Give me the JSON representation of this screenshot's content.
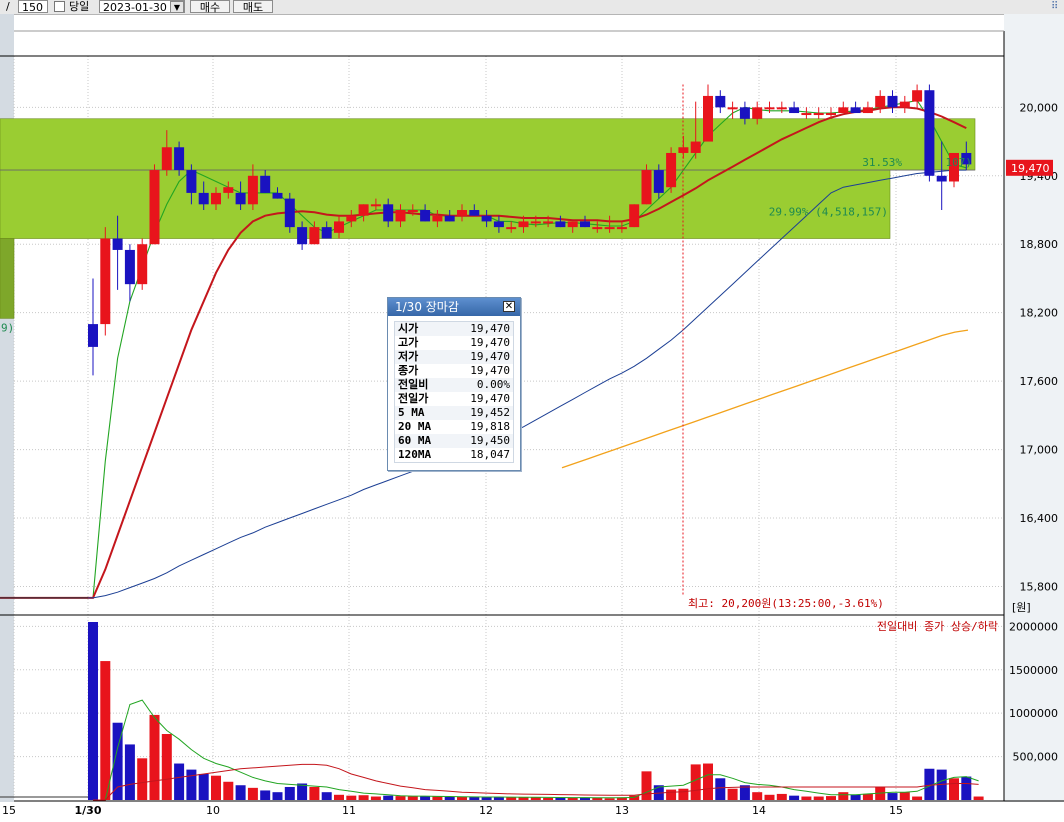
{
  "toolbar": {
    "slash": "/",
    "period": "150",
    "sameday_label": "당일",
    "date": "2023-01-30",
    "buy_label": "매수",
    "sell_label": "매도",
    "settings_icon": "grid-dots-icon",
    "dropdown_icon": "triangle-down-icon"
  },
  "popup": {
    "title": "1/30 장마감",
    "close_icon": "close-icon",
    "rows": [
      {
        "label": "시가",
        "value": "19,470"
      },
      {
        "label": "고가",
        "value": "19,470"
      },
      {
        "label": "저가",
        "value": "19,470"
      },
      {
        "label": "종가",
        "value": "19,470"
      },
      {
        "label": "전일비",
        "value": "0.00%"
      },
      {
        "label": "전일가",
        "value": "19,470"
      },
      {
        "label": "5  MA",
        "value": "19,452"
      },
      {
        "label": "20 MA",
        "value": "19,818"
      },
      {
        "label": "60 MA",
        "value": "19,450"
      },
      {
        "label": "120MA",
        "value": "18,047"
      }
    ]
  },
  "colors": {
    "up": "#e8141c",
    "down": "#1a12c0",
    "zone": "#9acd32",
    "ma5": "#22a522",
    "ma20": "#c4161c",
    "ma60": "#1c3f94",
    "ma120": "#f2a21b",
    "price_tag": "#e8141c"
  },
  "chart_data": {
    "type": "candlestick",
    "price_axis": {
      "ticks": [
        "20,000",
        "19,400",
        "18,800",
        "18,200",
        "17,600",
        "17,000",
        "16,400",
        "15,800"
      ],
      "unit": "[원]",
      "current_price_tag": "19,470",
      "range": [
        15550,
        20450
      ]
    },
    "time_axis": {
      "labels": [
        "15",
        "1/30",
        "10",
        "11",
        "12",
        "13",
        "14",
        "15"
      ]
    },
    "volume_axis": {
      "ticks": [
        "2000000",
        "1500000",
        "1000000",
        "500,000"
      ],
      "range": [
        0,
        2050000
      ]
    },
    "annotations": {
      "high_label": "최고: 20,200원(13:25:00,-3.61%)",
      "volume_note": "전일대비 종가 상승/하락",
      "zone_upper_label": "31.53%",
      "zone_upper_label_tail": "107)",
      "zone_lower_label": "29.99% (4,518,157)",
      "left_clipped_label": "9)"
    },
    "zones": [
      {
        "low": 19450,
        "high": 19900
      },
      {
        "low": 18850,
        "high": 19450
      },
      {
        "low": 18150,
        "high": 18850
      }
    ],
    "candles": [
      {
        "o": 18100,
        "h": 18500,
        "l": 17650,
        "c": 17900
      },
      {
        "o": 18100,
        "h": 18950,
        "l": 18000,
        "c": 18850
      },
      {
        "o": 18850,
        "h": 19050,
        "l": 18400,
        "c": 18750
      },
      {
        "o": 18750,
        "h": 18800,
        "l": 18300,
        "c": 18450
      },
      {
        "o": 18450,
        "h": 18850,
        "l": 18400,
        "c": 18800
      },
      {
        "o": 18800,
        "h": 19500,
        "l": 18800,
        "c": 19450
      },
      {
        "o": 19450,
        "h": 19800,
        "l": 19400,
        "c": 19650
      },
      {
        "o": 19650,
        "h": 19700,
        "l": 19400,
        "c": 19450
      },
      {
        "o": 19450,
        "h": 19500,
        "l": 19150,
        "c": 19250
      },
      {
        "o": 19250,
        "h": 19350,
        "l": 19100,
        "c": 19150
      },
      {
        "o": 19150,
        "h": 19300,
        "l": 19100,
        "c": 19250
      },
      {
        "o": 19250,
        "h": 19350,
        "l": 19200,
        "c": 19300
      },
      {
        "o": 19250,
        "h": 19350,
        "l": 19100,
        "c": 19150
      },
      {
        "o": 19150,
        "h": 19500,
        "l": 19100,
        "c": 19400
      },
      {
        "o": 19400,
        "h": 19450,
        "l": 19250,
        "c": 19250
      },
      {
        "o": 19250,
        "h": 19300,
        "l": 19200,
        "c": 19200
      },
      {
        "o": 19200,
        "h": 19250,
        "l": 18900,
        "c": 18950
      },
      {
        "o": 18950,
        "h": 19000,
        "l": 18750,
        "c": 18800
      },
      {
        "o": 18800,
        "h": 19000,
        "l": 18800,
        "c": 18950
      },
      {
        "o": 18950,
        "h": 19000,
        "l": 18850,
        "c": 18850
      },
      {
        "o": 18900,
        "h": 19050,
        "l": 18850,
        "c": 19000
      },
      {
        "o": 19000,
        "h": 19100,
        "l": 18950,
        "c": 19050
      },
      {
        "o": 19050,
        "h": 19150,
        "l": 19000,
        "c": 19150
      },
      {
        "o": 19150,
        "h": 19200,
        "l": 19100,
        "c": 19150
      },
      {
        "o": 19150,
        "h": 19200,
        "l": 18950,
        "c": 19000
      },
      {
        "o": 19000,
        "h": 19150,
        "l": 18950,
        "c": 19100
      },
      {
        "o": 19100,
        "h": 19150,
        "l": 19050,
        "c": 19100
      },
      {
        "o": 19100,
        "h": 19150,
        "l": 19000,
        "c": 19000
      },
      {
        "o": 19000,
        "h": 19100,
        "l": 18950,
        "c": 19050
      },
      {
        "o": 19050,
        "h": 19100,
        "l": 19000,
        "c": 19000
      },
      {
        "o": 19050,
        "h": 19150,
        "l": 19000,
        "c": 19100
      },
      {
        "o": 19100,
        "h": 19150,
        "l": 19050,
        "c": 19050
      },
      {
        "o": 19050,
        "h": 19100,
        "l": 18950,
        "c": 19000
      },
      {
        "o": 19000,
        "h": 19050,
        "l": 18900,
        "c": 18950
      },
      {
        "o": 18950,
        "h": 19000,
        "l": 18900,
        "c": 18950
      },
      {
        "o": 18950,
        "h": 19050,
        "l": 18900,
        "c": 19000
      },
      {
        "o": 19000,
        "h": 19050,
        "l": 18950,
        "c": 19000
      },
      {
        "o": 19000,
        "h": 19050,
        "l": 18950,
        "c": 19000
      },
      {
        "o": 19000,
        "h": 19050,
        "l": 18950,
        "c": 18950
      },
      {
        "o": 18950,
        "h": 19000,
        "l": 18900,
        "c": 19000
      },
      {
        "o": 19000,
        "h": 19050,
        "l": 18950,
        "c": 18950
      },
      {
        "o": 18950,
        "h": 19000,
        "l": 18900,
        "c": 18950
      },
      {
        "o": 18950,
        "h": 19050,
        "l": 18900,
        "c": 18950
      },
      {
        "o": 18950,
        "h": 19000,
        "l": 18900,
        "c": 18950
      },
      {
        "o": 18950,
        "h": 19150,
        "l": 18950,
        "c": 19150
      },
      {
        "o": 19150,
        "h": 19500,
        "l": 19150,
        "c": 19450
      },
      {
        "o": 19450,
        "h": 19500,
        "l": 19200,
        "c": 19250
      },
      {
        "o": 19300,
        "h": 19650,
        "l": 19250,
        "c": 19600
      },
      {
        "o": 19600,
        "h": 19750,
        "l": 19550,
        "c": 19650
      },
      {
        "o": 19600,
        "h": 20050,
        "l": 19550,
        "c": 19700
      },
      {
        "o": 19700,
        "h": 20200,
        "l": 19700,
        "c": 20100
      },
      {
        "o": 20100,
        "h": 20150,
        "l": 19950,
        "c": 20000
      },
      {
        "o": 20000,
        "h": 20050,
        "l": 19900,
        "c": 20000
      },
      {
        "o": 20000,
        "h": 20050,
        "l": 19850,
        "c": 19900
      },
      {
        "o": 19900,
        "h": 20050,
        "l": 19850,
        "c": 20000
      },
      {
        "o": 20000,
        "h": 20050,
        "l": 19950,
        "c": 20000
      },
      {
        "o": 20000,
        "h": 20050,
        "l": 19950,
        "c": 20000
      },
      {
        "o": 20000,
        "h": 20050,
        "l": 19950,
        "c": 19950
      },
      {
        "o": 19950,
        "h": 20000,
        "l": 19900,
        "c": 19950
      },
      {
        "o": 19950,
        "h": 20000,
        "l": 19900,
        "c": 19950
      },
      {
        "o": 19950,
        "h": 20000,
        "l": 19900,
        "c": 19950
      },
      {
        "o": 19950,
        "h": 20050,
        "l": 19950,
        "c": 20000
      },
      {
        "o": 20000,
        "h": 20050,
        "l": 19950,
        "c": 19950
      },
      {
        "o": 19950,
        "h": 20050,
        "l": 19950,
        "c": 20000
      },
      {
        "o": 20000,
        "h": 20150,
        "l": 19950,
        "c": 20100
      },
      {
        "o": 20100,
        "h": 20150,
        "l": 19950,
        "c": 20000
      },
      {
        "o": 20000,
        "h": 20100,
        "l": 19950,
        "c": 20050
      },
      {
        "o": 20050,
        "h": 20200,
        "l": 20000,
        "c": 20150
      },
      {
        "o": 20150,
        "h": 20200,
        "l": 19350,
        "c": 19400
      },
      {
        "o": 19400,
        "h": 19700,
        "l": 19100,
        "c": 19350
      },
      {
        "o": 19350,
        "h": 19600,
        "l": 19300,
        "c": 19600
      },
      {
        "o": 19600,
        "h": 19700,
        "l": 19450,
        "c": 19500
      }
    ],
    "volumes": [
      2050000,
      1600000,
      890000,
      640000,
      480000,
      980000,
      760000,
      420000,
      350000,
      300000,
      280000,
      210000,
      170000,
      140000,
      110000,
      90000,
      150000,
      190000,
      150000,
      90000,
      60000,
      50000,
      55000,
      40000,
      50000,
      45000,
      40000,
      45000,
      40000,
      35000,
      40000,
      35000,
      30000,
      35000,
      30000,
      35000,
      30000,
      25000,
      30000,
      25000,
      30000,
      25000,
      20000,
      30000,
      50000,
      330000,
      170000,
      120000,
      130000,
      410000,
      420000,
      250000,
      130000,
      170000,
      90000,
      60000,
      70000,
      50000,
      40000,
      40000,
      45000,
      90000,
      60000,
      70000,
      150000,
      80000,
      90000,
      40000,
      360000,
      350000,
      250000,
      270000,
      40000
    ],
    "series": [
      {
        "name": "5 MA",
        "values": [
          15700,
          16900,
          17800,
          18300,
          18600,
          18900,
          19150,
          19350,
          19450,
          19400,
          19350,
          19300,
          19250,
          19250,
          19250,
          19250,
          19150,
          19050,
          18950,
          18900,
          18950,
          19000,
          19050,
          19100,
          19100,
          19100,
          19100,
          19100,
          19050,
          19050,
          19050,
          19050,
          19050,
          19000,
          19000,
          18980,
          18970,
          18980,
          18990,
          18990,
          18980,
          18970,
          18960,
          18960,
          19000,
          19100,
          19200,
          19300,
          19450,
          19600,
          19750,
          19850,
          19950,
          20000,
          19980,
          19970,
          19970,
          19970,
          19960,
          19950,
          19950,
          19960,
          19970,
          19980,
          20000,
          20020,
          20040,
          20060,
          19900,
          19700,
          19500,
          19470
        ]
      },
      {
        "name": "20 MA",
        "values": [
          15700,
          15950,
          16250,
          16550,
          16850,
          17150,
          17450,
          17750,
          18050,
          18300,
          18550,
          18750,
          18900,
          19000,
          19050,
          19070,
          19080,
          19090,
          19080,
          19060,
          19050,
          19050,
          19060,
          19070,
          19080,
          19080,
          19070,
          19060,
          19060,
          19050,
          19050,
          19050,
          19050,
          19050,
          19040,
          19030,
          19030,
          19030,
          19020,
          19010,
          19010,
          19010,
          19000,
          19000,
          19020,
          19060,
          19110,
          19170,
          19230,
          19290,
          19360,
          19420,
          19480,
          19540,
          19600,
          19660,
          19720,
          19770,
          19820,
          19870,
          19910,
          19940,
          19960,
          19970,
          19990,
          20000,
          20000,
          19990,
          19960,
          19920,
          19870,
          19818
        ]
      },
      {
        "name": "60 MA",
        "values": [
          15700,
          15720,
          15750,
          15790,
          15830,
          15870,
          15920,
          15980,
          16030,
          16080,
          16130,
          16180,
          16230,
          16270,
          16320,
          16360,
          16400,
          16440,
          16480,
          16520,
          16560,
          16600,
          16650,
          16690,
          16730,
          16770,
          16810,
          16850,
          16890,
          16930,
          16970,
          17010,
          17050,
          17100,
          17150,
          17200,
          17260,
          17320,
          17380,
          17440,
          17500,
          17560,
          17620,
          17670,
          17730,
          17800,
          17880,
          17960,
          18050,
          18150,
          18250,
          18350,
          18450,
          18550,
          18650,
          18750,
          18850,
          18950,
          19050,
          19150,
          19250,
          19300,
          19320,
          19340,
          19360,
          19380,
          19400,
          19420,
          19430,
          19440,
          19450,
          19450
        ]
      },
      {
        "name": "120 MA",
        "values": [
          16840,
          16880,
          16920,
          16960,
          17000,
          17040,
          17080,
          17120,
          17160,
          17200,
          17240,
          17280,
          17320,
          17360,
          17400,
          17440,
          17480,
          17520,
          17560,
          17600,
          17640,
          17680,
          17720,
          17760,
          17800,
          17840,
          17880,
          17920,
          17960,
          18000,
          18030,
          18047
        ]
      },
      {
        "name": "volume MA",
        "values": [
          0,
          0,
          600000,
          1100000,
          1150000,
          950000,
          800000,
          700000,
          580000,
          480000,
          420000,
          380000,
          320000,
          260000,
          220000,
          190000,
          180000,
          170000,
          160000,
          150000,
          120000,
          100000,
          80000,
          70000,
          60000,
          50000,
          45000,
          45000,
          42000,
          40000,
          38000,
          36000,
          35000,
          34000,
          33000,
          32000,
          31000,
          30000,
          29000,
          28000,
          28000,
          27000,
          26000,
          26000,
          30000,
          90000,
          150000,
          160000,
          170000,
          230000,
          290000,
          290000,
          250000,
          200000,
          180000,
          170000,
          150000,
          120000,
          100000,
          80000,
          60000,
          60000,
          60000,
          70000,
          80000,
          90000,
          90000,
          100000,
          160000,
          220000,
          260000,
          270000,
          220000
        ]
      },
      {
        "name": "volume MA long",
        "values": [
          0,
          0,
          150000,
          180000,
          200000,
          220000,
          240000,
          260000,
          280000,
          300000,
          320000,
          340000,
          360000,
          370000,
          380000,
          390000,
          400000,
          410000,
          410000,
          400000,
          360000,
          300000,
          260000,
          220000,
          190000,
          160000,
          140000,
          120000,
          110000,
          100000,
          90000,
          85000,
          80000,
          75000,
          70000,
          68000,
          66000,
          64000,
          62000,
          60000,
          58000,
          56000,
          55000,
          54000,
          55000,
          70000,
          80000,
          90000,
          95000,
          110000,
          130000,
          140000,
          145000,
          150000,
          150000,
          150000,
          150000,
          150000,
          150000,
          150000,
          150000,
          150000,
          150000,
          150000,
          150000,
          150000,
          150000,
          150000,
          170000,
          180000,
          190000,
          190000,
          180000
        ]
      }
    ]
  }
}
